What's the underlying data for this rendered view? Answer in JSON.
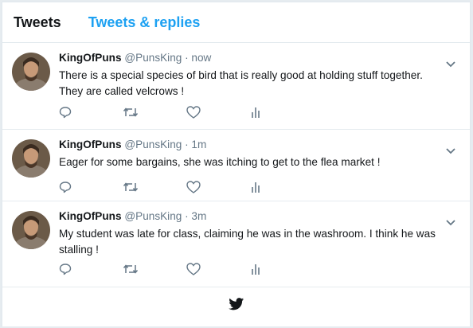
{
  "tabs": [
    {
      "label": "Tweets",
      "active": true
    },
    {
      "label": "Tweets & replies",
      "active": false
    }
  ],
  "tweets": [
    {
      "name": "KingOfPuns",
      "handle": "@PunsKing",
      "time": "now",
      "text": "There is a special species of bird that is really good at holding stuff together. They are called velcrows !"
    },
    {
      "name": "KingOfPuns",
      "handle": "@PunsKing",
      "time": "1m",
      "text": "Eager for some bargains, she was itching to get to the flea market !"
    },
    {
      "name": "KingOfPuns",
      "handle": "@PunsKing",
      "time": "3m",
      "text": "My student was late for class, claiming he was in the washroom. I think he was stalling !"
    }
  ],
  "colors": {
    "accent": "#1da1f2",
    "muted": "#657786",
    "icon": "#657786"
  },
  "icons": [
    "reply-icon",
    "retweet-icon",
    "like-icon",
    "analytics-icon",
    "caret-down-icon",
    "twitter-bird-icon"
  ]
}
